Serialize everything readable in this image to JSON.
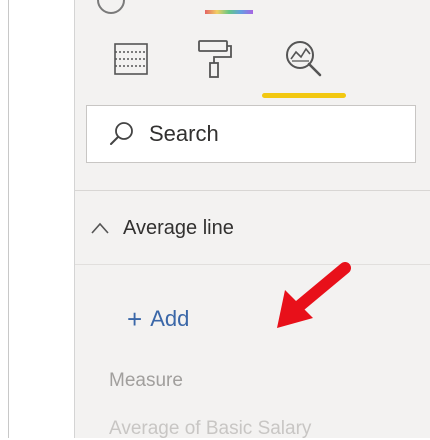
{
  "search": {
    "placeholder": "Search"
  },
  "icons": {
    "fields": "fields-icon",
    "format": "format-paint-roller-icon",
    "analytics": "analytics-magnifier-icon",
    "search": "search-icon",
    "section": "chevron-up-icon",
    "add": "plus-icon"
  },
  "section": {
    "title": "Average line"
  },
  "add": {
    "plus": "+",
    "label": "Add"
  },
  "measure": {
    "label": "Measure",
    "value": "Average of Basic Salary"
  },
  "colors": {
    "accent_underline": "#f2c811",
    "link_blue": "#3a67a8",
    "annotation_red": "#e8101a",
    "panel_bg": "#f3f2f1"
  }
}
